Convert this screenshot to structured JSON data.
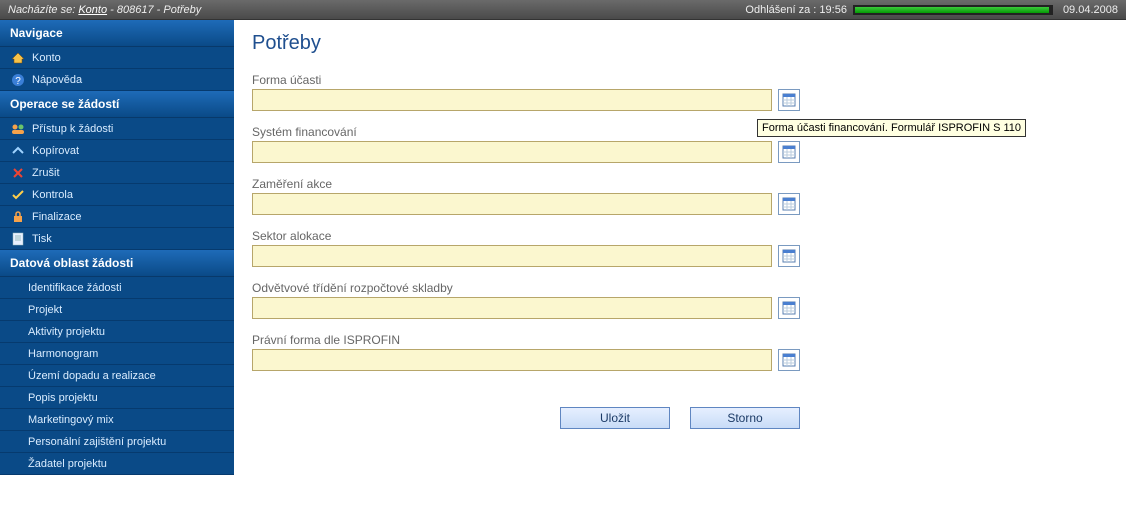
{
  "topbar": {
    "location_prefix": "Nacházíte se:",
    "crumb_link": "Konto",
    "crumb_sep1": " - ",
    "crumb_id": "808617",
    "crumb_sep2": " - ",
    "crumb_page": "Potřeby",
    "logout_label": "Odhlášení za :",
    "logout_time": "19:56",
    "date": "09.04.2008"
  },
  "sidebar": {
    "section_nav": "Navigace",
    "items_nav": [
      {
        "label": "Konto"
      },
      {
        "label": "Nápověda"
      }
    ],
    "section_ops": "Operace se žádostí",
    "items_ops": [
      {
        "label": "Přístup k žádosti"
      },
      {
        "label": "Kopírovat"
      },
      {
        "label": "Zrušit"
      },
      {
        "label": "Kontrola"
      },
      {
        "label": "Finalizace"
      },
      {
        "label": "Tisk"
      }
    ],
    "section_data": "Datová oblast žádosti",
    "items_data": [
      {
        "label": "Identifikace žádosti"
      },
      {
        "label": "Projekt"
      },
      {
        "label": "Aktivity projektu"
      },
      {
        "label": "Harmonogram"
      },
      {
        "label": "Území dopadu a realizace"
      },
      {
        "label": "Popis projektu"
      },
      {
        "label": "Marketingový mix"
      },
      {
        "label": "Personální zajištění projektu"
      },
      {
        "label": "Žadatel projektu"
      }
    ]
  },
  "main": {
    "title": "Potřeby",
    "fields": {
      "forma_ucasti": {
        "label": "Forma účasti",
        "value": ""
      },
      "system_financovani": {
        "label": "Systém financování",
        "value": ""
      },
      "zamereni_akce": {
        "label": "Zaměření akce",
        "value": ""
      },
      "sektor_alokace": {
        "label": "Sektor alokace",
        "value": ""
      },
      "odvetvove_trideni": {
        "label": "Odvětvové třídění rozpočtové skladby",
        "value": ""
      },
      "pravni_forma": {
        "label": "Právní forma dle ISPROFIN",
        "value": ""
      }
    },
    "tooltip": "Forma účasti financování. Formulář ISPROFIN S 110",
    "buttons": {
      "save": "Uložit",
      "cancel": "Storno"
    }
  }
}
